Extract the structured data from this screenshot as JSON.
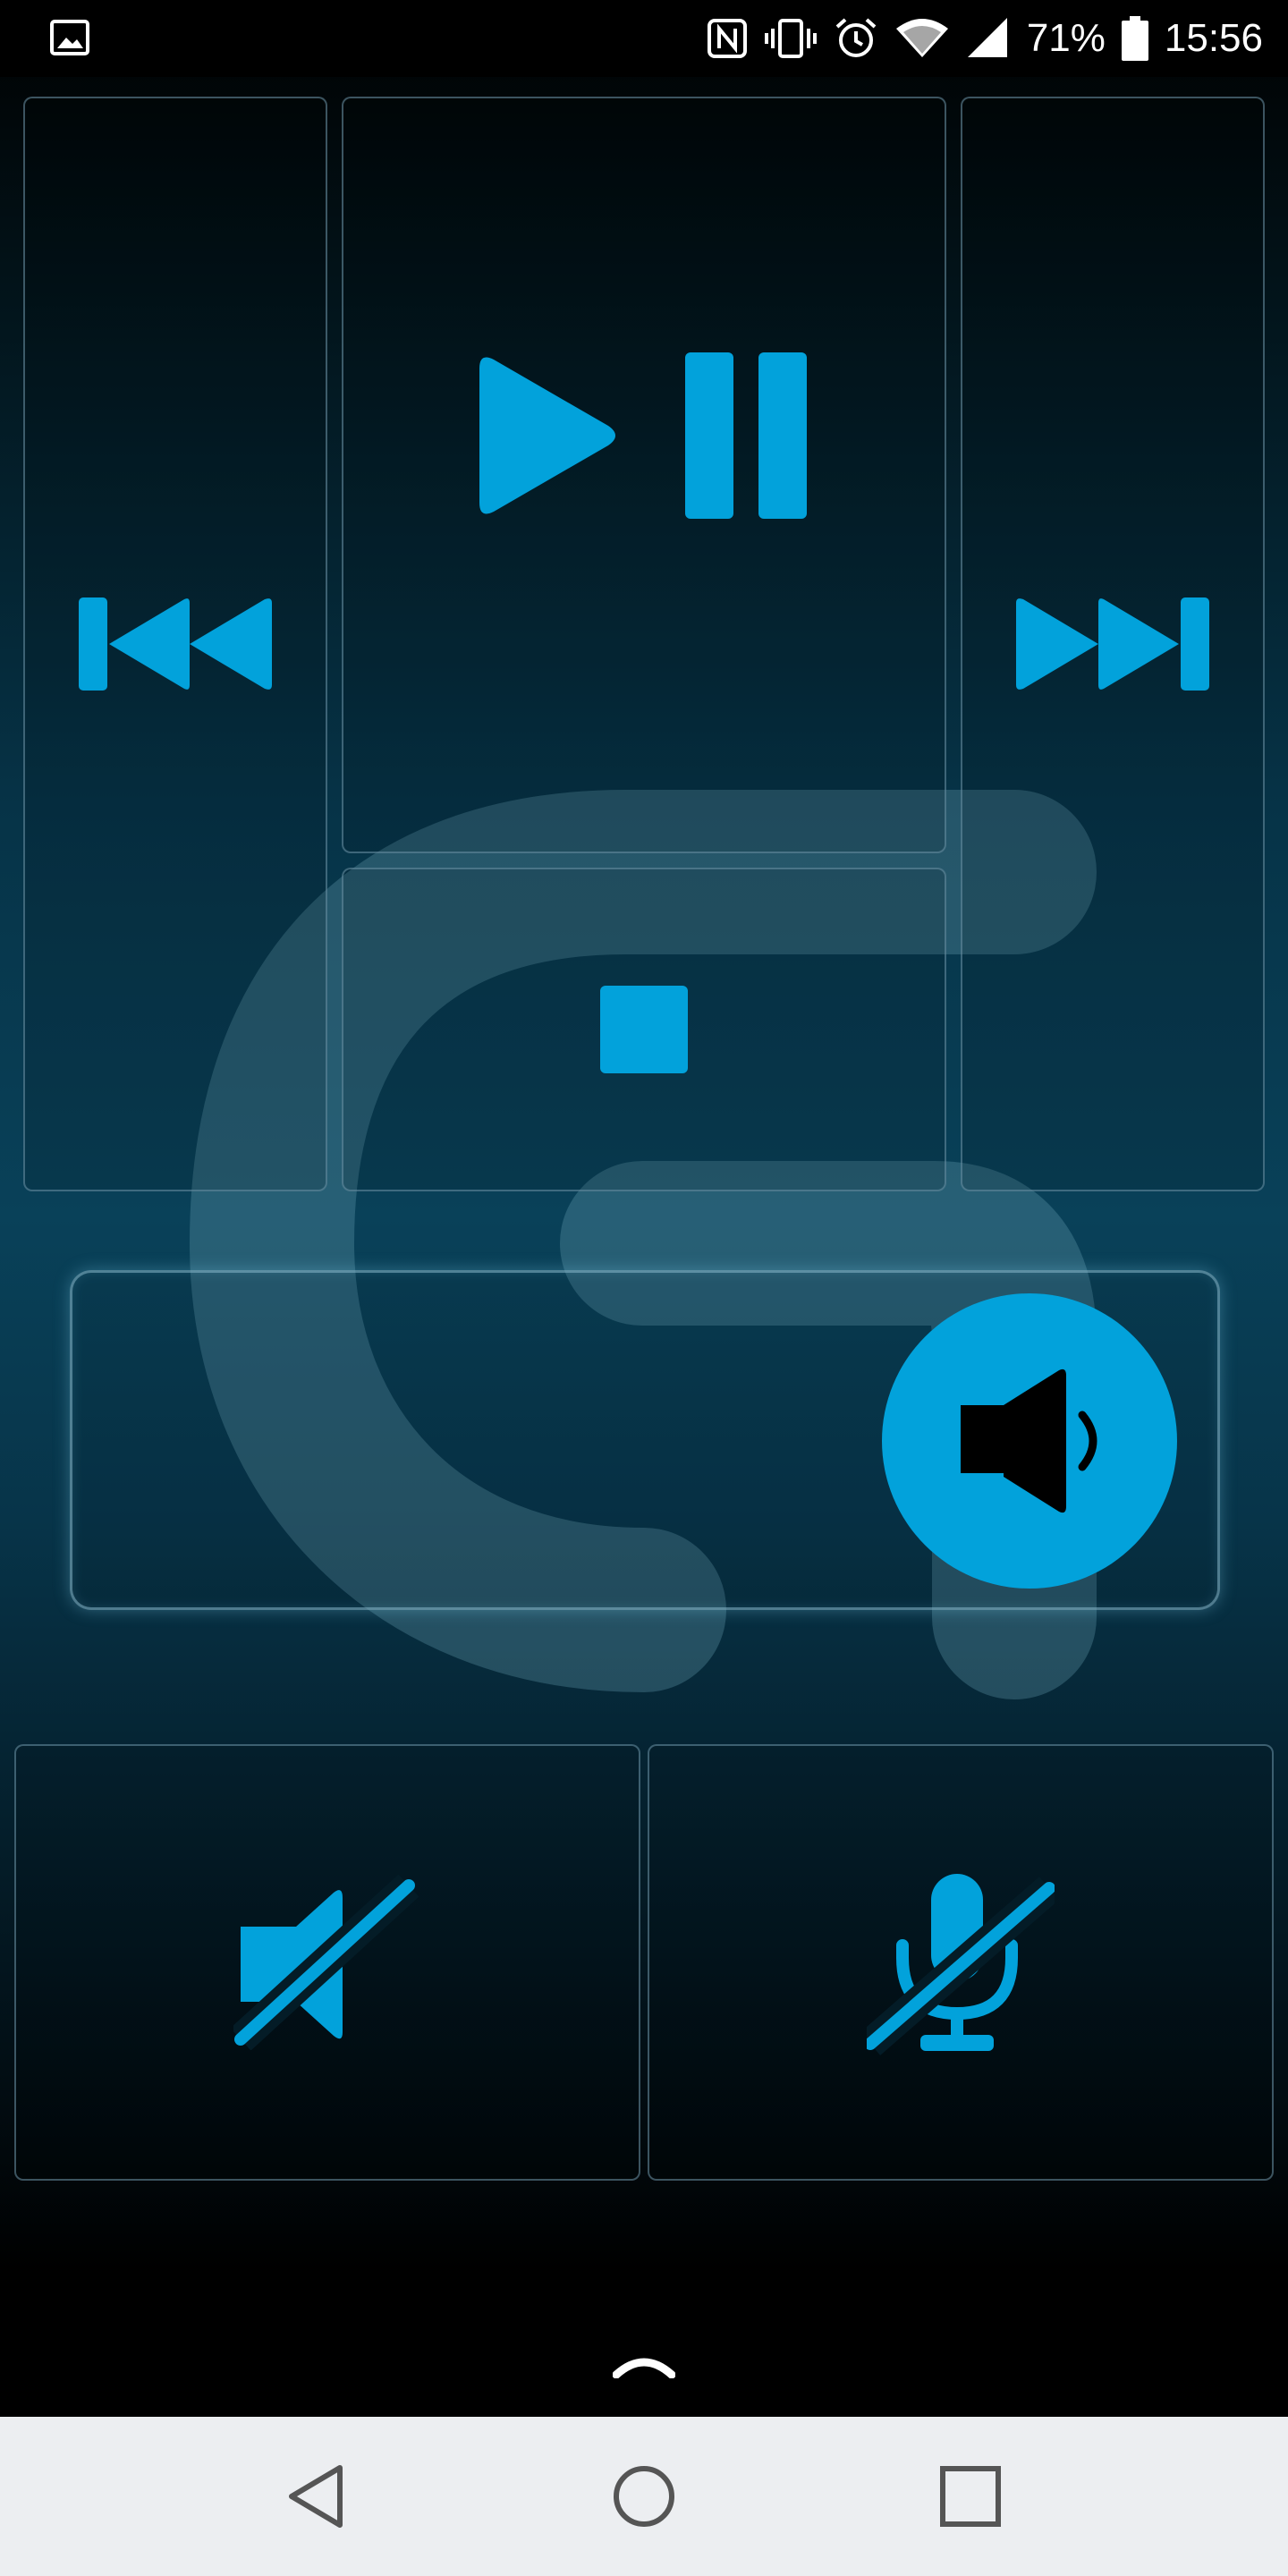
{
  "status_bar": {
    "battery_percent": "71%",
    "time": "15:56"
  },
  "colors": {
    "accent": "#02a2db",
    "background_top": "#000000",
    "background_mid": "#094159",
    "panel_border": "#5f8799",
    "nav_bar": "#eceef1"
  },
  "icons": {
    "gallery_notification": "image-icon",
    "nfc": "nfc-icon",
    "vibrate": "vibrate-icon",
    "alarm": "alarm-clock-icon",
    "wifi": "wifi-icon",
    "signal": "cellular-signal-icon",
    "battery": "battery-icon",
    "previous": "skip-previous-icon",
    "play_pause": "play-pause-icon",
    "next": "skip-next-icon",
    "stop": "stop-icon",
    "volume": "volume-icon",
    "mute": "volume-mute-icon",
    "mic_mute": "microphone-off-icon",
    "expand": "chevron-up-icon",
    "back": "back-triangle-icon",
    "home": "home-circle-icon",
    "recents": "recents-square-icon"
  },
  "controls": {
    "volume_level": 0.85
  }
}
